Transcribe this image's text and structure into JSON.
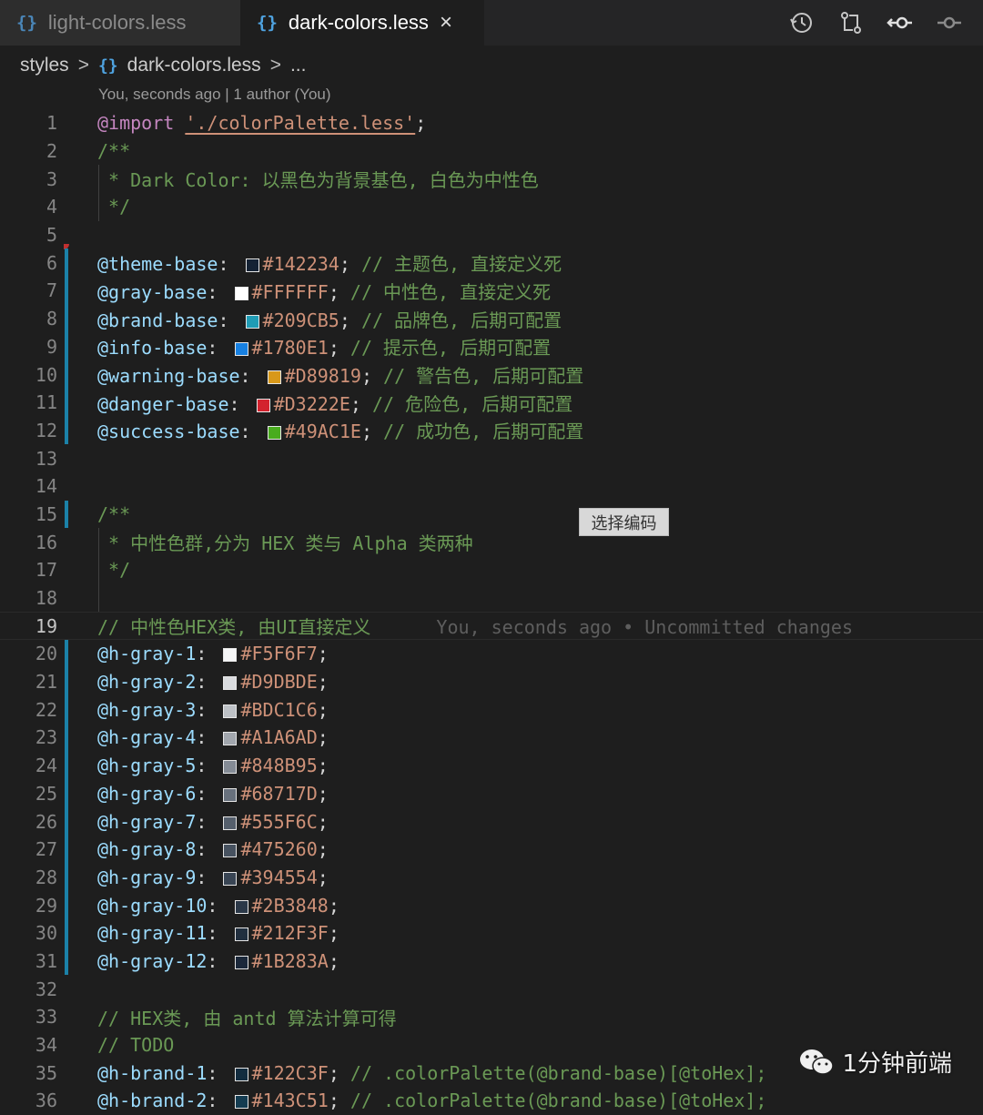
{
  "tabs": [
    {
      "icon": "{}",
      "label": "light-colors.less",
      "active": false
    },
    {
      "icon": "{}",
      "label": "dark-colors.less",
      "active": true,
      "close": "×"
    }
  ],
  "actions": [
    "history-icon",
    "compare-changes-icon",
    "go-back-change-icon",
    "go-forward-change-icon"
  ],
  "breadcrumb": {
    "folder": "styles",
    "icon": "{}",
    "file": "dark-colors.less",
    "more": "...",
    "separator": ">"
  },
  "blame_header": "You, seconds ago | 1 author (You)",
  "tooltip": "选择编码",
  "watermark": {
    "text": "1分钟前端",
    "icon": "wechat-icon"
  },
  "lines": [
    {
      "n": "1",
      "code": [
        [
          "at",
          "@import"
        ],
        [
          "punc",
          " "
        ],
        [
          "str",
          "'./colorPalette.less'"
        ],
        [
          "punc",
          ";"
        ]
      ]
    },
    {
      "n": "2",
      "code": [
        [
          "cmt",
          "/**"
        ]
      ]
    },
    {
      "n": "3",
      "guide": true,
      "code": [
        [
          "cmt",
          " * Dark Color: 以黑色为背景基色, 白色为中性色"
        ]
      ]
    },
    {
      "n": "4",
      "guide": true,
      "code": [
        [
          "cmt",
          " */"
        ]
      ]
    },
    {
      "n": "5",
      "code": []
    },
    {
      "n": "6",
      "bar": true,
      "code": [
        [
          "var",
          "@theme-base"
        ],
        [
          "punc",
          ": "
        ],
        [
          "sw",
          "#142234"
        ],
        [
          "hex",
          "#142234"
        ],
        [
          "punc",
          "; "
        ],
        [
          "cmt",
          "// 主题色, 直接定义死"
        ]
      ]
    },
    {
      "n": "7",
      "bar": true,
      "code": [
        [
          "var",
          "@gray-base"
        ],
        [
          "punc",
          ": "
        ],
        [
          "sw",
          "#FFFFFF"
        ],
        [
          "hex",
          "#FFFFFF"
        ],
        [
          "punc",
          "; "
        ],
        [
          "cmt",
          "// 中性色, 直接定义死"
        ]
      ]
    },
    {
      "n": "8",
      "bar": true,
      "code": [
        [
          "var",
          "@brand-base"
        ],
        [
          "punc",
          ": "
        ],
        [
          "sw",
          "#209CB5"
        ],
        [
          "hex",
          "#209CB5"
        ],
        [
          "punc",
          "; "
        ],
        [
          "cmt",
          "// 品牌色, 后期可配置"
        ]
      ]
    },
    {
      "n": "9",
      "bar": true,
      "code": [
        [
          "var",
          "@info-base"
        ],
        [
          "punc",
          ": "
        ],
        [
          "sw",
          "#1780E1"
        ],
        [
          "hex",
          "#1780E1"
        ],
        [
          "punc",
          "; "
        ],
        [
          "cmt",
          "// 提示色, 后期可配置"
        ]
      ]
    },
    {
      "n": "10",
      "bar": true,
      "code": [
        [
          "var",
          "@warning-base"
        ],
        [
          "punc",
          ": "
        ],
        [
          "sw",
          "#D89819"
        ],
        [
          "hex",
          "#D89819"
        ],
        [
          "punc",
          "; "
        ],
        [
          "cmt",
          "// 警告色, 后期可配置"
        ]
      ]
    },
    {
      "n": "11",
      "bar": true,
      "code": [
        [
          "var",
          "@danger-base"
        ],
        [
          "punc",
          ": "
        ],
        [
          "sw",
          "#D3222E"
        ],
        [
          "hex",
          "#D3222E"
        ],
        [
          "punc",
          "; "
        ],
        [
          "cmt",
          "// 危险色, 后期可配置"
        ]
      ]
    },
    {
      "n": "12",
      "bar": true,
      "code": [
        [
          "var",
          "@success-base"
        ],
        [
          "punc",
          ": "
        ],
        [
          "sw",
          "#49AC1E"
        ],
        [
          "hex",
          "#49AC1E"
        ],
        [
          "punc",
          "; "
        ],
        [
          "cmt",
          "// 成功色, 后期可配置"
        ]
      ]
    },
    {
      "n": "13",
      "code": []
    },
    {
      "n": "14",
      "code": []
    },
    {
      "n": "15",
      "bar": true,
      "code": [
        [
          "cmt",
          "/**"
        ]
      ]
    },
    {
      "n": "16",
      "guide": true,
      "code": [
        [
          "cmt",
          " * 中性色群,分为 HEX 类与 Alpha 类两种"
        ]
      ]
    },
    {
      "n": "17",
      "guide": true,
      "code": [
        [
          "cmt",
          " */"
        ]
      ]
    },
    {
      "n": "18",
      "guide": true,
      "code": []
    },
    {
      "n": "19",
      "current": true,
      "code": [
        [
          "cmt",
          "// 中性色HEX类, 由UI直接定义"
        ]
      ],
      "blame": "You, seconds ago • Uncommitted changes"
    },
    {
      "n": "20",
      "bar": true,
      "code": [
        [
          "var",
          "@h-gray-1"
        ],
        [
          "punc",
          ": "
        ],
        [
          "sw",
          "#F5F6F7"
        ],
        [
          "hex",
          "#F5F6F7"
        ],
        [
          "punc",
          ";"
        ]
      ]
    },
    {
      "n": "21",
      "bar": true,
      "code": [
        [
          "var",
          "@h-gray-2"
        ],
        [
          "punc",
          ": "
        ],
        [
          "sw",
          "#D9DBDE"
        ],
        [
          "hex",
          "#D9DBDE"
        ],
        [
          "punc",
          ";"
        ]
      ]
    },
    {
      "n": "22",
      "bar": true,
      "code": [
        [
          "var",
          "@h-gray-3"
        ],
        [
          "punc",
          ": "
        ],
        [
          "sw",
          "#BDC1C6"
        ],
        [
          "hex",
          "#BDC1C6"
        ],
        [
          "punc",
          ";"
        ]
      ]
    },
    {
      "n": "23",
      "bar": true,
      "code": [
        [
          "var",
          "@h-gray-4"
        ],
        [
          "punc",
          ": "
        ],
        [
          "sw",
          "#A1A6AD"
        ],
        [
          "hex",
          "#A1A6AD"
        ],
        [
          "punc",
          ";"
        ]
      ]
    },
    {
      "n": "24",
      "bar": true,
      "code": [
        [
          "var",
          "@h-gray-5"
        ],
        [
          "punc",
          ": "
        ],
        [
          "sw",
          "#848B95"
        ],
        [
          "hex",
          "#848B95"
        ],
        [
          "punc",
          ";"
        ]
      ]
    },
    {
      "n": "25",
      "bar": true,
      "code": [
        [
          "var",
          "@h-gray-6"
        ],
        [
          "punc",
          ": "
        ],
        [
          "sw",
          "#68717D"
        ],
        [
          "hex",
          "#68717D"
        ],
        [
          "punc",
          ";"
        ]
      ]
    },
    {
      "n": "26",
      "bar": true,
      "code": [
        [
          "var",
          "@h-gray-7"
        ],
        [
          "punc",
          ": "
        ],
        [
          "sw",
          "#555F6C"
        ],
        [
          "hex",
          "#555F6C"
        ],
        [
          "punc",
          ";"
        ]
      ]
    },
    {
      "n": "27",
      "bar": true,
      "code": [
        [
          "var",
          "@h-gray-8"
        ],
        [
          "punc",
          ": "
        ],
        [
          "sw",
          "#475260"
        ],
        [
          "hex",
          "#475260"
        ],
        [
          "punc",
          ";"
        ]
      ]
    },
    {
      "n": "28",
      "bar": true,
      "code": [
        [
          "var",
          "@h-gray-9"
        ],
        [
          "punc",
          ": "
        ],
        [
          "sw",
          "#394554"
        ],
        [
          "hex",
          "#394554"
        ],
        [
          "punc",
          ";"
        ]
      ]
    },
    {
      "n": "29",
      "bar": true,
      "code": [
        [
          "var",
          "@h-gray-10"
        ],
        [
          "punc",
          ": "
        ],
        [
          "sw",
          "#2B3848"
        ],
        [
          "hex",
          "#2B3848"
        ],
        [
          "punc",
          ";"
        ]
      ]
    },
    {
      "n": "30",
      "bar": true,
      "code": [
        [
          "var",
          "@h-gray-11"
        ],
        [
          "punc",
          ": "
        ],
        [
          "sw",
          "#212F3F"
        ],
        [
          "hex",
          "#212F3F"
        ],
        [
          "punc",
          ";"
        ]
      ]
    },
    {
      "n": "31",
      "bar": true,
      "code": [
        [
          "var",
          "@h-gray-12"
        ],
        [
          "punc",
          ": "
        ],
        [
          "sw",
          "#1B283A"
        ],
        [
          "hex",
          "#1B283A"
        ],
        [
          "punc",
          ";"
        ]
      ]
    },
    {
      "n": "32",
      "code": []
    },
    {
      "n": "33",
      "code": [
        [
          "cmt",
          "// HEX类, 由 antd 算法计算可得"
        ]
      ]
    },
    {
      "n": "34",
      "code": [
        [
          "cmt",
          "// TODO"
        ]
      ]
    },
    {
      "n": "35",
      "code": [
        [
          "var",
          "@h-brand-1"
        ],
        [
          "punc",
          ": "
        ],
        [
          "sw",
          "#122C3F"
        ],
        [
          "hex",
          "#122C3F"
        ],
        [
          "punc",
          "; "
        ],
        [
          "cmt",
          "// .colorPalette(@brand-base)[@toHex];"
        ]
      ]
    },
    {
      "n": "36",
      "code": [
        [
          "var",
          "@h-brand-2"
        ],
        [
          "punc",
          ": "
        ],
        [
          "sw",
          "#143C51"
        ],
        [
          "hex",
          "#143C51"
        ],
        [
          "punc",
          "; "
        ],
        [
          "cmt",
          "// .colorPalette(@brand-base)[@toHex];"
        ]
      ]
    }
  ]
}
